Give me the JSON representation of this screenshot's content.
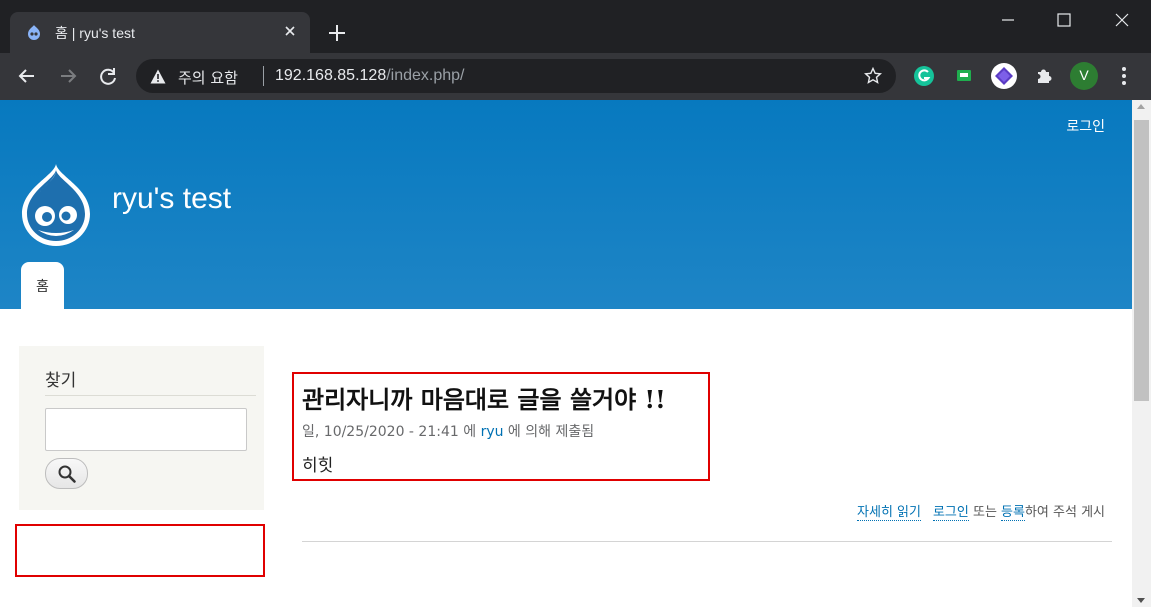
{
  "browser": {
    "tab": {
      "title": "홈 | ryu's test"
    },
    "address": {
      "security_label": "주의 요함",
      "host": "192.168.85.128",
      "path": "/index.php/"
    },
    "profile_initial": "V"
  },
  "header": {
    "login_link": "로그인",
    "site_name": "ryu's test",
    "nav": [
      {
        "label": "홈"
      }
    ]
  },
  "sidebar": {
    "search": {
      "title": "찾기",
      "input_value": ""
    }
  },
  "article": {
    "title": "관리자니까 마음대로 글을 쓸거야 !!",
    "meta_prefix": "일, 10/25/2020 - 21:41 에 ",
    "author": "ryu",
    "meta_suffix": " 에 의해 제출됨",
    "body": "히힛"
  },
  "links": {
    "read_more": "자세히 읽기",
    "login": "로그인",
    "or": " 또는 ",
    "register": "등록",
    "comment_suffix": "하여 주석 게시"
  },
  "colors": {
    "header_top": "#0779bf",
    "header_bottom": "#1e85c6",
    "highlight_box": "#e00000",
    "link": "#0071b3"
  }
}
